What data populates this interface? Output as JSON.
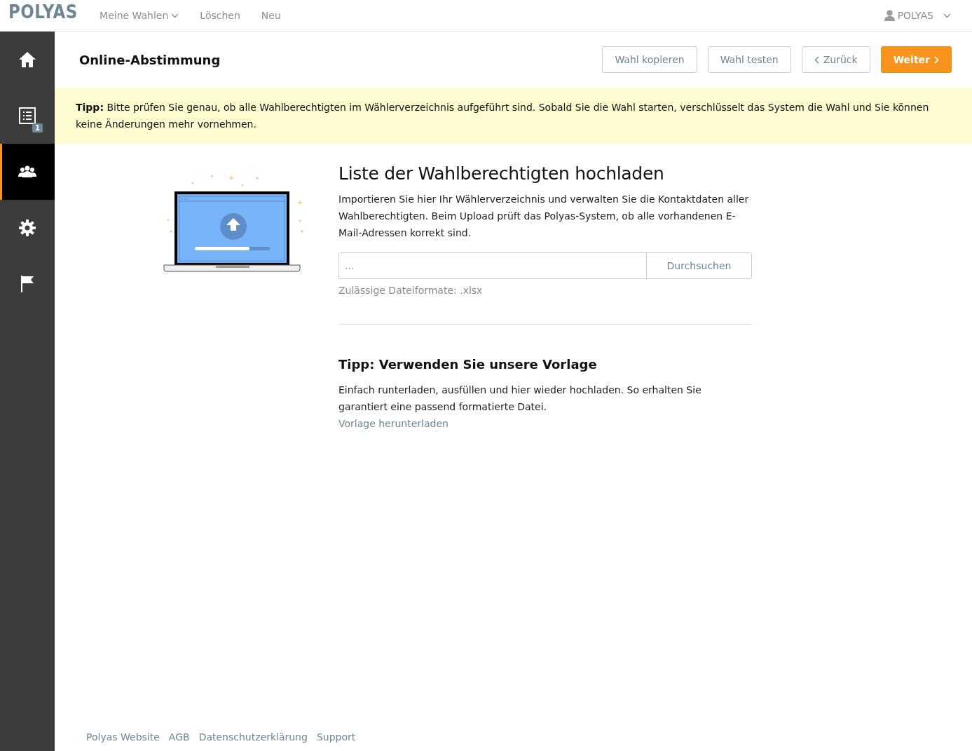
{
  "topbar": {
    "logo": "POLYAS",
    "menu": [
      {
        "label": "Meine Wahlen",
        "dropdown": true
      },
      {
        "label": "Löschen",
        "dropdown": false
      },
      {
        "label": "Neu",
        "dropdown": false
      }
    ],
    "user": "POLYAS"
  },
  "sidebar": {
    "items": [
      {
        "kind": "home",
        "selected": false
      },
      {
        "kind": "list",
        "badge": "1",
        "selected": false
      },
      {
        "kind": "people",
        "selected": true
      },
      {
        "kind": "gear",
        "selected": false
      },
      {
        "kind": "flag",
        "selected": false
      }
    ]
  },
  "header": {
    "title": "Online-Abstimmung",
    "buttons": [
      {
        "label": "Wahl kopieren",
        "kind": "plain"
      },
      {
        "label": "Wahl testen",
        "kind": "plain"
      },
      {
        "label": "Zurück",
        "kind": "back"
      },
      {
        "label": "Weiter",
        "kind": "next"
      }
    ]
  },
  "tip_banner": "**Tipp:** Bitte prüfen Sie genau, ob alle Wahlberechtigten im Wählerverzeichnis aufgeführt sind. Sobald Sie die Wahl starten, verschlüsselt das System die Wahl und Sie können keine Änderungen mehr vornehmen.",
  "upload": {
    "heading": "Liste der Wahlberechtigten hochladen",
    "text": "Importieren Sie hier Ihr Wählerverzeichnis und verwalten Sie die Kontaktdaten aller Wahlberechtigten. Beim Upload prüft das Polyas-System, ob alle vorhandenen E-Mail-Adressen korrekt sind.",
    "file_field": {
      "placeholder": "..."
    },
    "browse_button": "Durchsuchen",
    "hint": "Zulässige Dateiformate: .xlsx",
    "progress": {
      "level": 0.73
    }
  },
  "template": {
    "heading": "Tipp: Verwenden Sie unsere Vorlage",
    "text": "Einfach runterladen, ausfüllen und hier wieder hochladen. So erhalten Sie garantiert eine passend formatierte Datei.",
    "link": "Vorlage herunterladen"
  },
  "footer": {
    "links": [
      "Polyas Website",
      "AGB",
      "Datenschutzerklärung",
      "Support"
    ]
  }
}
